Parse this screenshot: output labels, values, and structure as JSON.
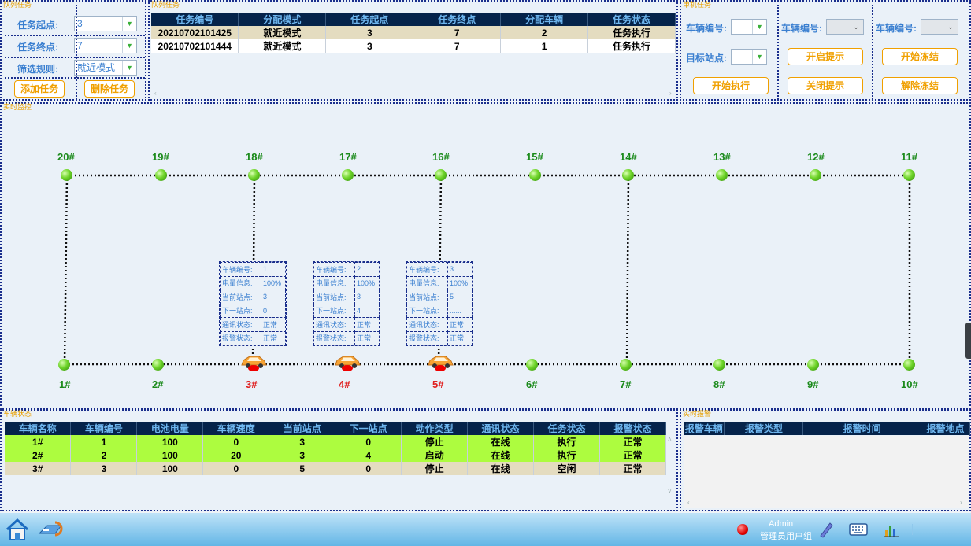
{
  "queue_panel": {
    "title": "队列任务",
    "start_label": "任务起点:",
    "start_value": "3",
    "end_label": "任务终点:",
    "end_value": "7",
    "rule_label": "筛选规则:",
    "rule_value": "就近模式",
    "add_button": "添加任务",
    "delete_button": "删除任务"
  },
  "task_table": {
    "title": "队列任务",
    "headers": [
      "任务编号",
      "分配模式",
      "任务起点",
      "任务终点",
      "分配车辆",
      "任务状态"
    ],
    "rows": [
      [
        "20210702101425",
        "就近模式",
        "3",
        "7",
        "2",
        "任务执行"
      ],
      [
        "20210702101444",
        "就近模式",
        "3",
        "7",
        "1",
        "任务执行"
      ]
    ]
  },
  "single_task": {
    "title": "单机任务",
    "vehicle_label": "车辆编号:",
    "target_label": "目标站点:",
    "start_button": "开始执行",
    "vehicle_label2": "车辆编号:",
    "open_prompt": "开启提示",
    "close_prompt": "关闭提示",
    "vehicle_label3": "车辆编号:",
    "start_freeze": "开始冻结",
    "release_freeze": "解除冻结"
  },
  "monitor": {
    "title": "实时监控",
    "top_stations": [
      "20#",
      "19#",
      "18#",
      "17#",
      "16#",
      "15#",
      "14#",
      "13#",
      "12#",
      "11#"
    ],
    "bottom_stations": [
      "1#",
      "2#",
      "3#",
      "4#",
      "5#",
      "6#",
      "7#",
      "8#",
      "9#",
      "10#"
    ],
    "info_labels": [
      "车辆编号:",
      "电量信息:",
      "当前站点:",
      "下一站点:",
      "通讯状态:",
      "报警状态:"
    ],
    "cars": [
      {
        "values": [
          "1",
          "100%",
          "3",
          "0",
          "正常",
          "正常"
        ]
      },
      {
        "values": [
          "2",
          "100%",
          "3",
          "4",
          "正常",
          "正常"
        ]
      },
      {
        "values": [
          "3",
          "100%",
          "5",
          "......",
          "正常",
          "正常"
        ]
      }
    ]
  },
  "vehicle_panel": {
    "title": "车辆状态",
    "headers": [
      "车辆名称",
      "车辆编号",
      "电池电量",
      "车辆速度",
      "当前站点",
      "下一站点",
      "动作类型",
      "通讯状态",
      "任务状态",
      "报警状态"
    ],
    "rows": [
      [
        "1#",
        "1",
        "100",
        "0",
        "3",
        "0",
        "停止",
        "在线",
        "执行",
        "正常"
      ],
      [
        "2#",
        "2",
        "100",
        "20",
        "3",
        "4",
        "启动",
        "在线",
        "执行",
        "正常"
      ],
      [
        "3#",
        "3",
        "100",
        "0",
        "5",
        "0",
        "停止",
        "在线",
        "空闲",
        "正常"
      ]
    ]
  },
  "alarm_panel": {
    "title": "实时报警",
    "headers": [
      "报警车辆",
      "报警类型",
      "报警时间",
      "报警地点"
    ]
  },
  "taskbar": {
    "user": "Admin",
    "role": "管理员用户组"
  },
  "colors": {
    "accent": "#f0a000",
    "header_bg": "#05234a",
    "station_green": "#5ac820",
    "row_green": "#adfc3f",
    "row_beige": "#e4dcc0"
  }
}
